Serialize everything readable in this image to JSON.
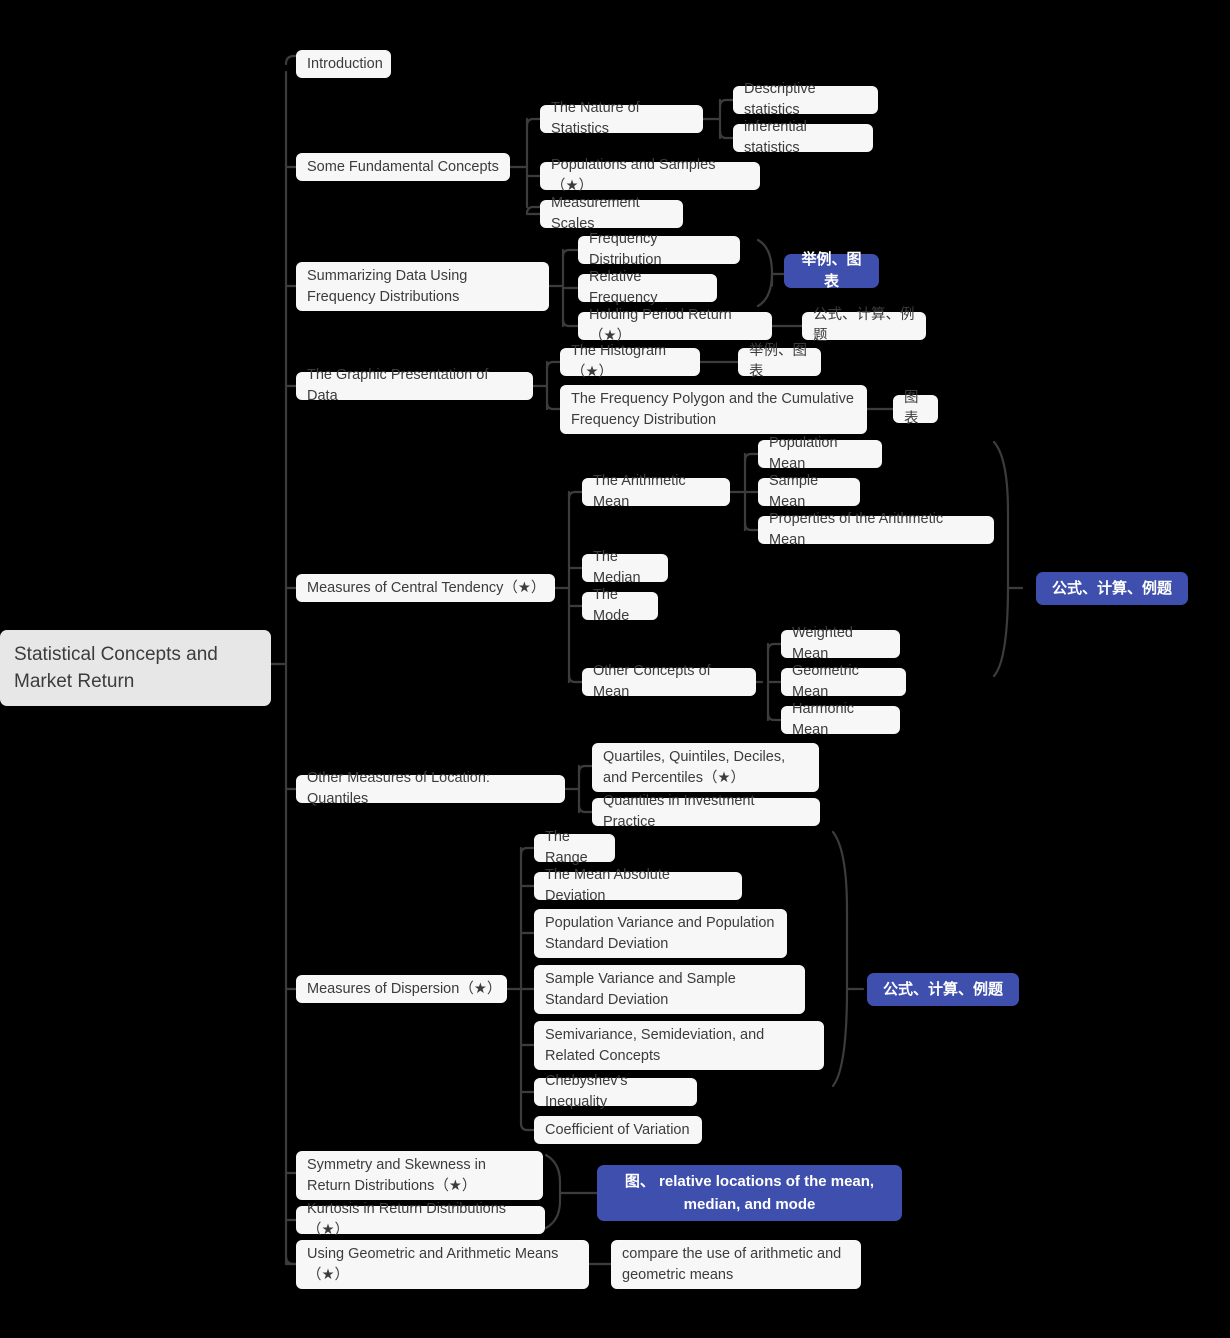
{
  "title": "Statistical Concepts and Market Return",
  "theme": {
    "background": "#000000",
    "node_bg": "#f7f7f7",
    "root_bg": "#e7e7e7",
    "text": "#3c3c3c",
    "badge_bg": "#3f4fad",
    "badge_text": "#ffffff",
    "link": "#3c3c3c"
  },
  "root": {
    "label": "Statistical Concepts and Market Return"
  },
  "nodes": {
    "introduction": "Introduction",
    "some_fundamental_concepts": "Some Fundamental Concepts",
    "the_nature_of_statistics": "The Nature of Statistics",
    "descriptive_statistics": "Descriptive statistics",
    "inferential_statistics": "inferential statistics",
    "populations_and_samples": "Populations and Samples（★）",
    "measurement_scales": "Measurement Scales",
    "summarizing_data": "Summarizing Data Using Frequency Distributions",
    "frequency_distribution": "Frequency Distribution",
    "relative_frequency": " Relative Frequency",
    "badge_examples_charts_1": "举例、图表",
    "holding_period_return": "Holding Period Return（★）",
    "formula_calc_example_1": "公式、计算、例题",
    "graphic_presentation": "The Graphic Presentation of Data",
    "the_histogram": "The Histogram（★）",
    "examples_charts_2": "举例、图表",
    "frequency_polygon": "The Frequency Polygon and the Cumulative Frequency Distribution",
    "charts_1": "图表",
    "measures_central_tendency": "Measures of Central Tendency（★）",
    "the_arithmetic_mean": "The Arithmetic Mean",
    "population_mean": "Population Mean",
    "sample_mean": "Sample Mean",
    "properties_arithmetic_mean": "Properties of the Arithmetic Mean",
    "the_median": "The Median",
    "the_mode": "The Mode",
    "other_concepts_of_mean": "Other Concepts of Mean",
    "weighted_mean": "Weighted Mean",
    "geometric_mean": "Geometric Mean",
    "harmonic_mean": "Harmonic Mean",
    "badge_formula_calc_example_2": "公式、计算、例题",
    "other_measures_location": "Other Measures of Location: Quantiles",
    "quartiles_quintiles": "Quartiles, Quintiles, Deciles, and Percentiles（★）",
    "quantiles_investment": "Quantiles in Investment Practice",
    "measures_of_dispersion": "Measures of Dispersion（★）",
    "the_range": "The Range",
    "mean_absolute_deviation": "The Mean Absolute Deviation",
    "population_variance": "Population Variance and Population Standard Deviation",
    "sample_variance": "Sample Variance and Sample Standard Deviation",
    "semivariance": "Semivariance, Semideviation, and Related Concepts",
    "chebyshevs_inequality": "Chebyshev's Inequality",
    "coefficient_of_variation": "Coefficient of Variation",
    "badge_formula_calc_example_3": "公式、计算、例题",
    "symmetry_and_skewness": "Symmetry and Skewness in Return Distributions（★）",
    "kurtosis": "Kurtosis in Return Distributions（★）",
    "badge_relative_locations": "图、 relative locations of the mean, median, and mode",
    "using_geometric_arithmetic": "Using Geometric and Arithmetic Means（★）",
    "compare_use": "compare the use of arithmetic and geometric means"
  }
}
